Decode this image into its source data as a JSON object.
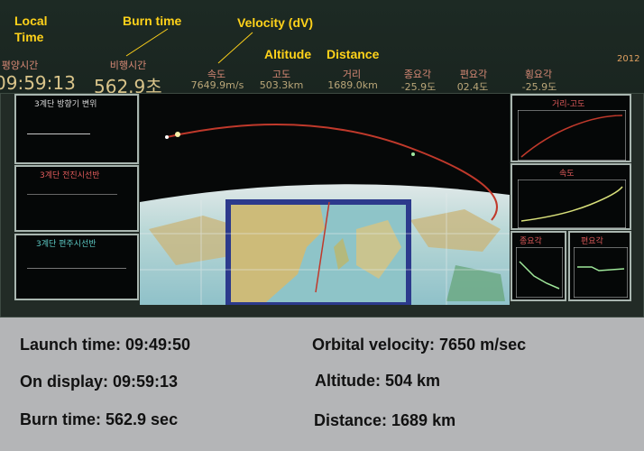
{
  "annotations": {
    "local_time": "Local\nTime",
    "burn_time": "Burn time",
    "velocity": "Velocity (dV)",
    "altitude": "Altitude",
    "distance": "Distance"
  },
  "display": {
    "corner_text": "2012",
    "header": [
      {
        "label": "평양시간",
        "value": "09:59:13"
      },
      {
        "label": "비행시간",
        "value": "562.9초"
      },
      {
        "label": "속도",
        "value": "7649.9m/s"
      },
      {
        "label": "고도",
        "value": "503.3km"
      },
      {
        "label": "거리",
        "value": "1689.0km"
      },
      {
        "label": "종요각",
        "value": "-25.9도"
      },
      {
        "label": "편요각",
        "value": "02.4도"
      },
      {
        "label": "횡요각",
        "value": "-25.9도"
      }
    ],
    "left_panels": [
      {
        "title": "3계단 방향기 변위"
      },
      {
        "title": "3계단 전진시선반"
      },
      {
        "title": "3계단 편주시선반"
      }
    ],
    "right_panels": [
      {
        "title": "거리-고도"
      },
      {
        "title": "속도"
      },
      {
        "title": "종요각"
      },
      {
        "title": "편요각"
      }
    ],
    "colors": {
      "trajectory": "#c0392b",
      "label_red": "#e25b5b",
      "annotation": "#ffd21a"
    }
  },
  "caption": {
    "launch_time": "Launch time: 09:49:50",
    "on_display": "On display: 09:59:13",
    "burn_time": "Burn time: 562.9 sec",
    "orbital_velocity": "Orbital velocity: 7650 m/sec",
    "altitude": "Altitude: 504 km",
    "distance": "Distance: 1689 km"
  }
}
